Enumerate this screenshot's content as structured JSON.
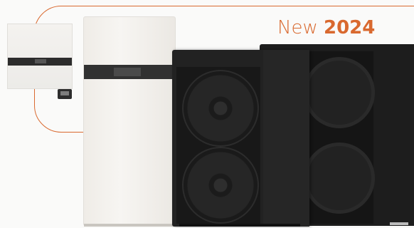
{
  "badge": {
    "word": "New",
    "year": "2024"
  },
  "colors": {
    "accent": "#d9692f",
    "unit_black": "#222222",
    "panel_white": "#f4f2ef"
  }
}
